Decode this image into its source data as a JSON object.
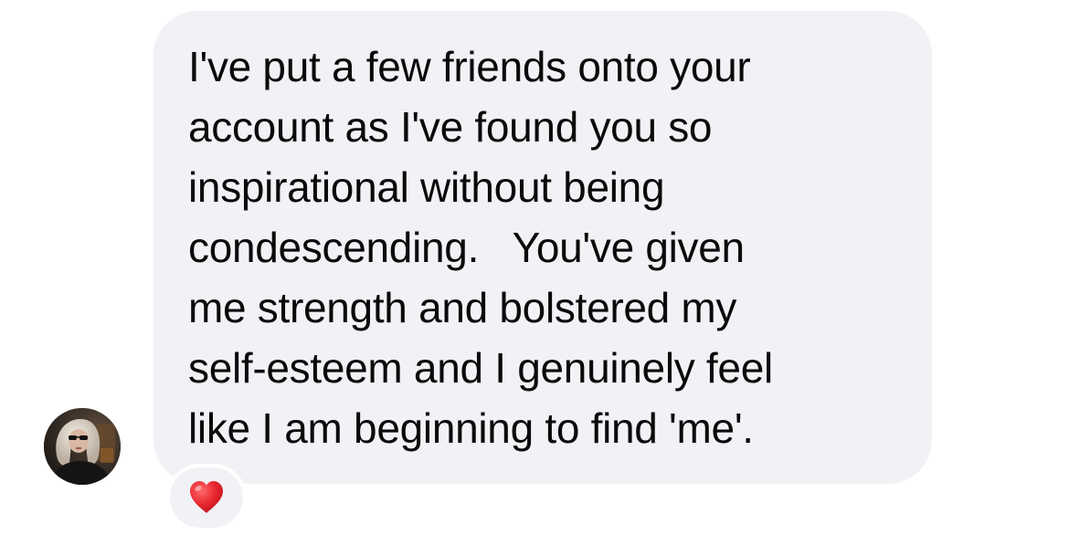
{
  "message": {
    "lines": [
      "I've put a few friends onto your",
      "account as I've found you so",
      "inspirational without being",
      "condescending.   You've given",
      "me strength and bolstered my",
      "self-esteem and I genuinely feel",
      "like I am beginning to find 'me'."
    ],
    "sender_avatar": "user-avatar-photo",
    "bubble_color": "#f1f2f5",
    "text_color": "#0a0a0a"
  },
  "reaction": {
    "icon": "red-heart-icon",
    "color": "#e8262e"
  }
}
